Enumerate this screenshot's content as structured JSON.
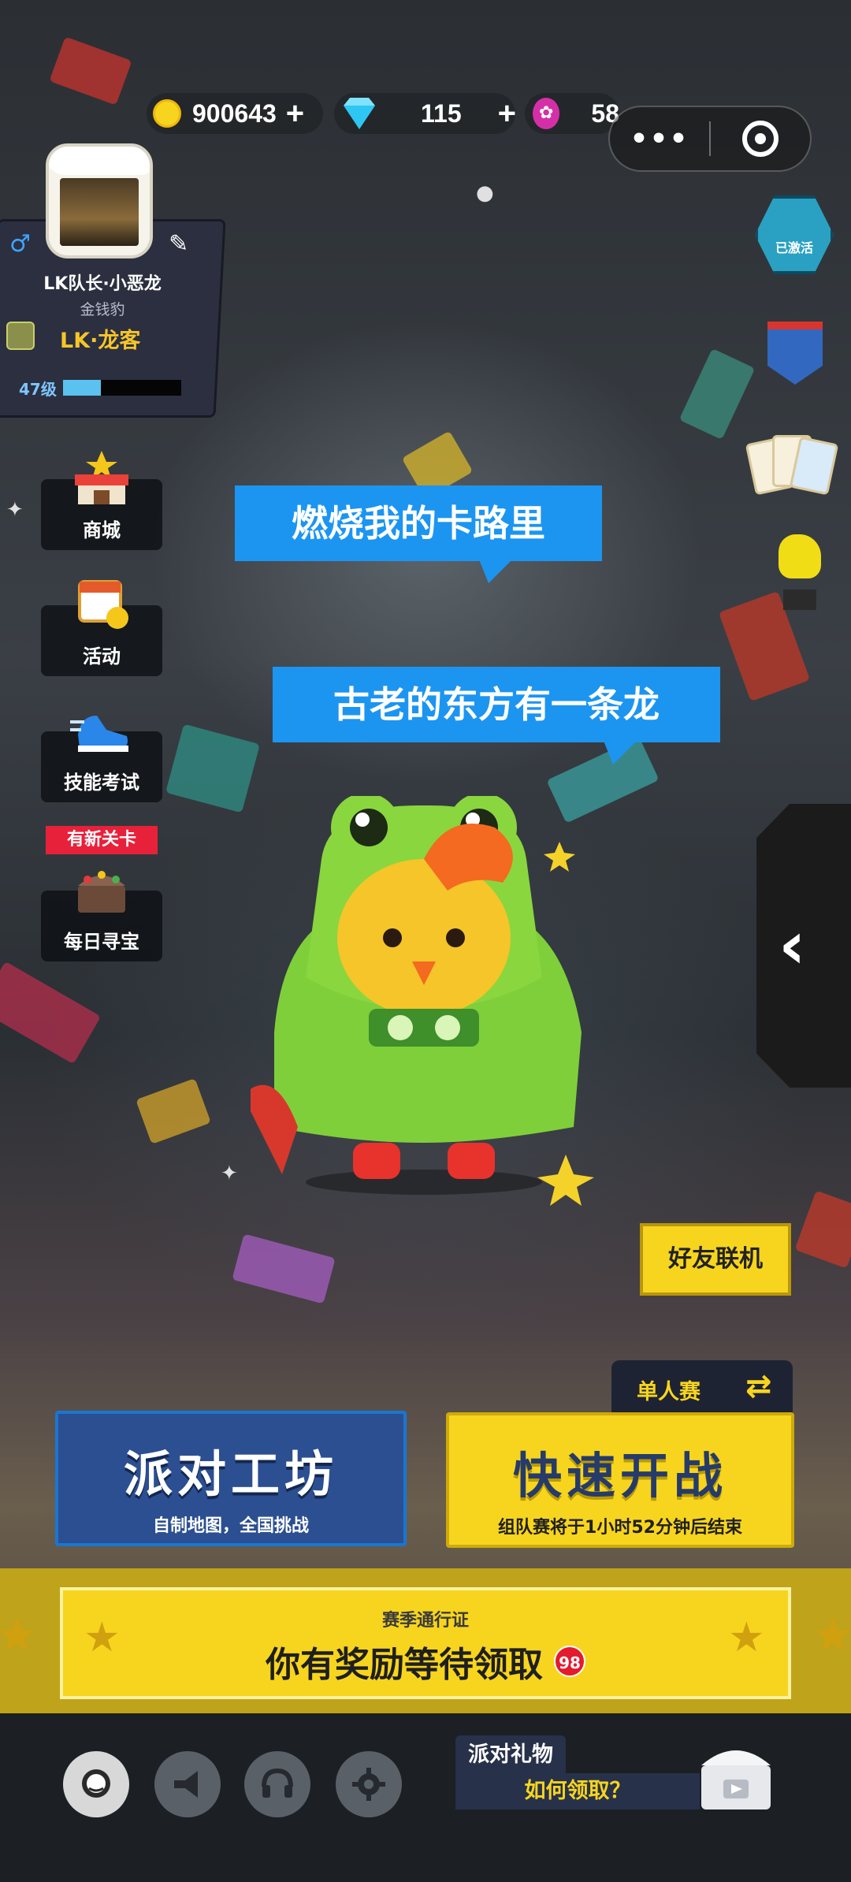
{
  "top_bar": {
    "coins": "900643",
    "gems": "115",
    "tokens": "58",
    "plus": "+"
  },
  "mini_program": {
    "more_icon": "more-dots-icon",
    "close_icon": "target-close-icon",
    "dots": "•••"
  },
  "profile": {
    "name": "LK队长·小恶龙",
    "title": "金钱豹",
    "club": "LK·龙客",
    "level": "47级",
    "level_progress": 0.32,
    "gender_symbol": "♂",
    "edit_symbol": "✎"
  },
  "left_menu": [
    {
      "label": "商城",
      "icon": "shop-icon"
    },
    {
      "label": "活动",
      "icon": "calendar-icon"
    },
    {
      "label": "技能考试",
      "icon": "sneaker-icon"
    },
    {
      "label": "每日寻宝",
      "icon": "treasure-chest-icon"
    }
  ],
  "new_level_tag": "有新关卡",
  "right_icons": {
    "badge_text": "已激活"
  },
  "bubbles": [
    "燃烧我的卡路里",
    "古老的东方有一条龙"
  ],
  "friend_button": "好友联机",
  "solo_tab": {
    "label": "单人赛",
    "swap_symbol": "⇄"
  },
  "party_workshop": {
    "title": "派对工坊",
    "subtitle": "自制地图，全国挑战"
  },
  "quick_battle": {
    "title": "快速开战",
    "subtitle": "组队赛将于1小时52分钟后结束"
  },
  "season_pass": {
    "small": "赛季通行证",
    "big": "你有奖励等待领取",
    "badge": "98"
  },
  "bottom_icons": [
    "chat-icon",
    "megaphone-icon",
    "headset-icon",
    "gear-icon"
  ],
  "party_gift": {
    "title": "派对礼物",
    "link": "如何领取？"
  },
  "colors": {
    "accent_yellow": "#f7d51e",
    "bubble_blue": "#1c95f1",
    "party_blue": "#2c4f92",
    "red_badge": "#e41a2e"
  }
}
